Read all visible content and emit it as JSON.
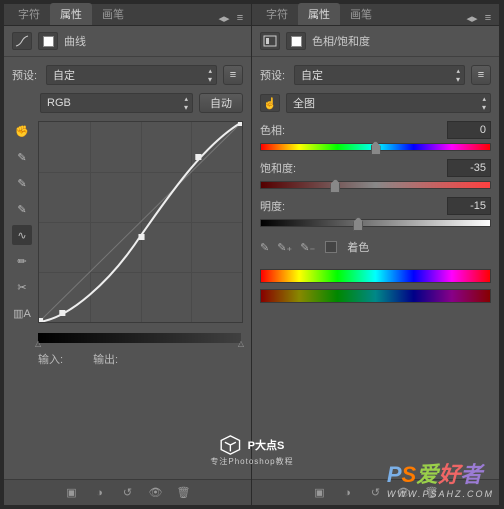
{
  "tabs": {
    "char": "字符",
    "props": "属性",
    "brush": "画笔"
  },
  "left": {
    "title": "曲线",
    "presetLabel": "预设:",
    "presetValue": "自定",
    "channel": "RGB",
    "autoBtn": "自动",
    "inputLabel": "输入:",
    "outputLabel": "输出:",
    "inputVal": "",
    "outputVal": ""
  },
  "right": {
    "title": "色相/饱和度",
    "presetLabel": "预设:",
    "presetValue": "自定",
    "range": "全图",
    "hueLabel": "色相:",
    "hueVal": "0",
    "satLabel": "饱和度:",
    "satVal": "-35",
    "ligLabel": "明度:",
    "ligVal": "-15",
    "colorize": "着色"
  },
  "brand": {
    "name": "P大点S",
    "sub": "专注Photoshop教程"
  },
  "wm": {
    "p": "P",
    "s": "S",
    "a": "爱",
    "h": "好",
    "z": "者",
    "site": "WWW.PSAHZ.COM"
  },
  "chart_data": {
    "type": "line",
    "title": "Curves",
    "xlabel": "输入",
    "ylabel": "输出",
    "xlim": [
      0,
      255
    ],
    "ylim": [
      0,
      255
    ],
    "series": [
      {
        "name": "baseline",
        "values": [
          [
            0,
            0
          ],
          [
            255,
            255
          ]
        ]
      },
      {
        "name": "curve",
        "values": [
          [
            0,
            0
          ],
          [
            30,
            10
          ],
          [
            128,
            110
          ],
          [
            200,
            210
          ],
          [
            255,
            255
          ]
        ]
      }
    ]
  }
}
